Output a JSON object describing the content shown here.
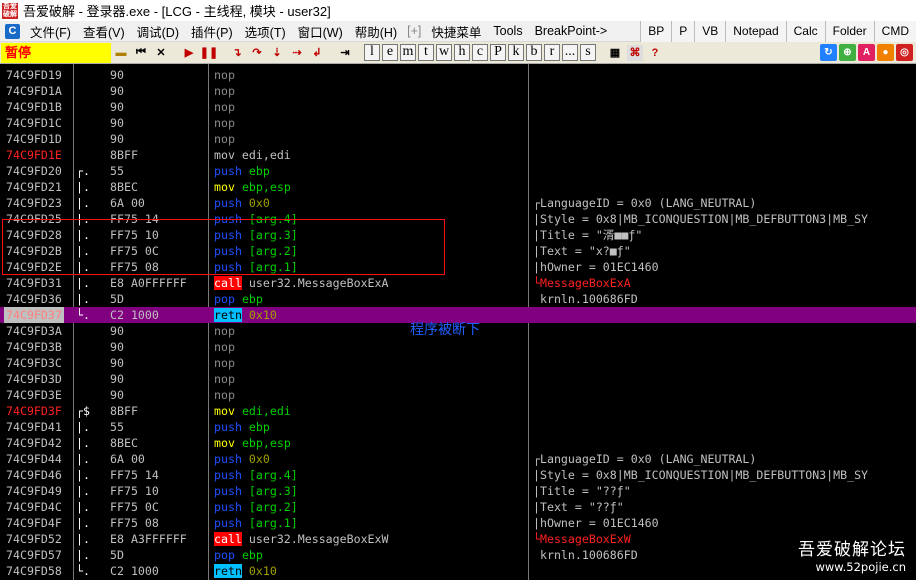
{
  "window": {
    "icon_text": "吾爱破解",
    "title": "吾爱破解 - 登录器.exe - [LCG - 主线程, 模块 - user32]"
  },
  "menu": {
    "logo": "C",
    "items": [
      "文件(F)",
      "查看(V)",
      "调试(D)",
      "插件(P)",
      "选项(T)",
      "窗口(W)",
      "帮助(H)"
    ],
    "extra": "[+]",
    "items2": [
      "快捷菜单",
      "Tools",
      "BreakPoint->"
    ],
    "tabs": [
      "BP",
      "P",
      "VB",
      "Notepad",
      "Calc",
      "Folder",
      "CMD"
    ]
  },
  "toolbar": {
    "status": "暂停",
    "buttons": [
      "open",
      "restart",
      "close",
      "run",
      "pause",
      "step-into",
      "step-over",
      "trace-into",
      "trace-over",
      "execute-till-return",
      "goto"
    ],
    "letters": [
      "l",
      "e",
      "m",
      "t",
      "w",
      "h",
      "c",
      "P",
      "k",
      "b",
      "r",
      "...",
      "s"
    ],
    "right_icons": [
      "refresh",
      "plugin",
      "A",
      "circle",
      "target"
    ]
  },
  "code": {
    "rows": [
      {
        "addr": "74C9FD19",
        "mark": "",
        "hex": "90",
        "asm": [
          [
            "nop",
            "nop"
          ]
        ],
        "com": []
      },
      {
        "addr": "74C9FD1A",
        "mark": "",
        "hex": "90",
        "asm": [
          [
            "nop",
            "nop"
          ]
        ],
        "com": []
      },
      {
        "addr": "74C9FD1B",
        "mark": "",
        "hex": "90",
        "asm": [
          [
            "nop",
            "nop"
          ]
        ],
        "com": []
      },
      {
        "addr": "74C9FD1C",
        "mark": "",
        "hex": "90",
        "asm": [
          [
            "nop",
            "nop"
          ]
        ],
        "com": []
      },
      {
        "addr": "74C9FD1D",
        "mark": "",
        "hex": "90",
        "asm": [
          [
            "nop",
            "nop"
          ]
        ],
        "com": []
      },
      {
        "addr": "74C9FD1E",
        "bp": true,
        "mark": "",
        "hex": "8BFF",
        "asm": [
          [
            "gray",
            "mov edi,edi"
          ]
        ],
        "com": []
      },
      {
        "addr": "74C9FD20",
        "mark": "┌.",
        "hex": "55",
        "asm": [
          [
            "blue",
            "push"
          ],
          [
            "gray",
            " "
          ],
          [
            "green",
            "ebp"
          ]
        ],
        "com": []
      },
      {
        "addr": "74C9FD21",
        "mark": "|.",
        "hex": "8BEC",
        "asm": [
          [
            "yellow",
            "mov"
          ],
          [
            "gray",
            " "
          ],
          [
            "green",
            "ebp,esp"
          ]
        ],
        "com": []
      },
      {
        "addr": "74C9FD23",
        "mark": "|.",
        "hex": "6A 00",
        "asm": [
          [
            "blue",
            "push"
          ],
          [
            "gray",
            " "
          ],
          [
            "green2",
            "0x0"
          ]
        ],
        "com": [
          [
            "gray",
            "┌LanguageID = 0x0 (LANG_NEUTRAL)"
          ]
        ]
      },
      {
        "addr": "74C9FD25",
        "mark": "|.",
        "hex": "FF75 14",
        "asm": [
          [
            "blue",
            "push"
          ],
          [
            "gray",
            " "
          ],
          [
            "green",
            "[arg.4]"
          ]
        ],
        "com": [
          [
            "gray",
            "|Style = 0x8|MB_ICONQUESTION|MB_DEFBUTTON3|MB_SY"
          ]
        ]
      },
      {
        "addr": "74C9FD28",
        "mark": "|.",
        "hex": "FF75 10",
        "asm": [
          [
            "blue",
            "push"
          ],
          [
            "gray",
            " "
          ],
          [
            "green",
            "[arg.3]"
          ]
        ],
        "com": [
          [
            "gray",
            "|Title = \"湑■■ƒ\""
          ]
        ]
      },
      {
        "addr": "74C9FD2B",
        "mark": "|.",
        "hex": "FF75 0C",
        "asm": [
          [
            "blue",
            "push"
          ],
          [
            "gray",
            " "
          ],
          [
            "green",
            "[arg.2]"
          ]
        ],
        "com": [
          [
            "gray",
            "|Text = \"x?■ƒ\""
          ]
        ]
      },
      {
        "addr": "74C9FD2E",
        "mark": "|.",
        "hex": "FF75 08",
        "asm": [
          [
            "blue",
            "push"
          ],
          [
            "gray",
            " "
          ],
          [
            "green",
            "[arg.1]"
          ]
        ],
        "com": [
          [
            "gray",
            "|hOwner = 01EC1460"
          ]
        ]
      },
      {
        "addr": "74C9FD31",
        "mark": "|.",
        "hex": "E8 A0FFFFFF",
        "asm": [
          [
            "call",
            "call"
          ],
          [
            "gray",
            " user32.MessageBoxExA"
          ]
        ],
        "com": [
          [
            "red",
            "└MessageBoxExA"
          ]
        ]
      },
      {
        "addr": "74C9FD36",
        "mark": "|.",
        "hex": "5D",
        "asm": [
          [
            "blue",
            "pop"
          ],
          [
            "gray",
            " "
          ],
          [
            "green",
            "ebp"
          ]
        ],
        "com": [
          [
            "gray",
            " krnln.100686FD"
          ]
        ]
      },
      {
        "addr": "74C9FD37",
        "current": true,
        "mark": "└.",
        "hex": "C2 1000",
        "asm": [
          [
            "retn",
            "retn"
          ],
          [
            "gray",
            " "
          ],
          [
            "green2",
            "0x10"
          ]
        ],
        "com": []
      },
      {
        "addr": "74C9FD3A",
        "mark": "",
        "hex": "90",
        "asm": [
          [
            "nop",
            "nop"
          ]
        ],
        "com": []
      },
      {
        "addr": "74C9FD3B",
        "mark": "",
        "hex": "90",
        "asm": [
          [
            "nop",
            "nop"
          ]
        ],
        "com": []
      },
      {
        "addr": "74C9FD3C",
        "mark": "",
        "hex": "90",
        "asm": [
          [
            "nop",
            "nop"
          ]
        ],
        "com": []
      },
      {
        "addr": "74C9FD3D",
        "mark": "",
        "hex": "90",
        "asm": [
          [
            "nop",
            "nop"
          ]
        ],
        "com": []
      },
      {
        "addr": "74C9FD3E",
        "mark": "",
        "hex": "90",
        "asm": [
          [
            "nop",
            "nop"
          ]
        ],
        "com": []
      },
      {
        "addr": "74C9FD3F",
        "bp": true,
        "mark": "┌$",
        "hex": "8BFF",
        "asm": [
          [
            "yellow",
            "mov"
          ],
          [
            "gray",
            " "
          ],
          [
            "green",
            "edi,edi"
          ]
        ],
        "com": []
      },
      {
        "addr": "74C9FD41",
        "mark": "|.",
        "hex": "55",
        "asm": [
          [
            "blue",
            "push"
          ],
          [
            "gray",
            " "
          ],
          [
            "green",
            "ebp"
          ]
        ],
        "com": []
      },
      {
        "addr": "74C9FD42",
        "mark": "|.",
        "hex": "8BEC",
        "asm": [
          [
            "yellow",
            "mov"
          ],
          [
            "gray",
            " "
          ],
          [
            "green",
            "ebp,esp"
          ]
        ],
        "com": []
      },
      {
        "addr": "74C9FD44",
        "mark": "|.",
        "hex": "6A 00",
        "asm": [
          [
            "blue",
            "push"
          ],
          [
            "gray",
            " "
          ],
          [
            "green2",
            "0x0"
          ]
        ],
        "com": [
          [
            "gray",
            "┌LanguageID = 0x0 (LANG_NEUTRAL)"
          ]
        ]
      },
      {
        "addr": "74C9FD46",
        "mark": "|.",
        "hex": "FF75 14",
        "asm": [
          [
            "blue",
            "push"
          ],
          [
            "gray",
            " "
          ],
          [
            "green",
            "[arg.4]"
          ]
        ],
        "com": [
          [
            "gray",
            "|Style = 0x8|MB_ICONQUESTION|MB_DEFBUTTON3|MB_SY"
          ]
        ]
      },
      {
        "addr": "74C9FD49",
        "mark": "|.",
        "hex": "FF75 10",
        "asm": [
          [
            "blue",
            "push"
          ],
          [
            "gray",
            " "
          ],
          [
            "green",
            "[arg.3]"
          ]
        ],
        "com": [
          [
            "gray",
            "|Title = \"??ƒ\""
          ]
        ]
      },
      {
        "addr": "74C9FD4C",
        "mark": "|.",
        "hex": "FF75 0C",
        "asm": [
          [
            "blue",
            "push"
          ],
          [
            "gray",
            " "
          ],
          [
            "green",
            "[arg.2]"
          ]
        ],
        "com": [
          [
            "gray",
            "|Text = \"??ƒ\""
          ]
        ]
      },
      {
        "addr": "74C9FD4F",
        "mark": "|.",
        "hex": "FF75 08",
        "asm": [
          [
            "blue",
            "push"
          ],
          [
            "gray",
            " "
          ],
          [
            "green",
            "[arg.1]"
          ]
        ],
        "com": [
          [
            "gray",
            "|hOwner = 01EC1460"
          ]
        ]
      },
      {
        "addr": "74C9FD52",
        "mark": "|.",
        "hex": "E8 A3FFFFFF",
        "asm": [
          [
            "call",
            "call"
          ],
          [
            "gray",
            " user32.MessageBoxExW"
          ]
        ],
        "com": [
          [
            "red",
            "└MessageBoxExW"
          ]
        ]
      },
      {
        "addr": "74C9FD57",
        "mark": "|.",
        "hex": "5D",
        "asm": [
          [
            "blue",
            "pop"
          ],
          [
            "gray",
            " "
          ],
          [
            "green",
            "ebp"
          ]
        ],
        "com": [
          [
            "gray",
            " krnln.100686FD"
          ]
        ]
      },
      {
        "addr": "74C9FD58",
        "mark": "└.",
        "hex": "C2 1000",
        "asm": [
          [
            "retn",
            "retn"
          ],
          [
            "gray",
            " "
          ],
          [
            "green2",
            "0x10"
          ]
        ],
        "com": []
      }
    ]
  },
  "annotation": "程序被断下",
  "watermark": {
    "title": "吾爱破解论坛",
    "url": "www.52pojie.cn"
  },
  "colors": {
    "current_line": "#800080",
    "breakpoint": "#ff2020",
    "highlight_box": "#ff1010",
    "paused_bg": "#ffff00"
  }
}
